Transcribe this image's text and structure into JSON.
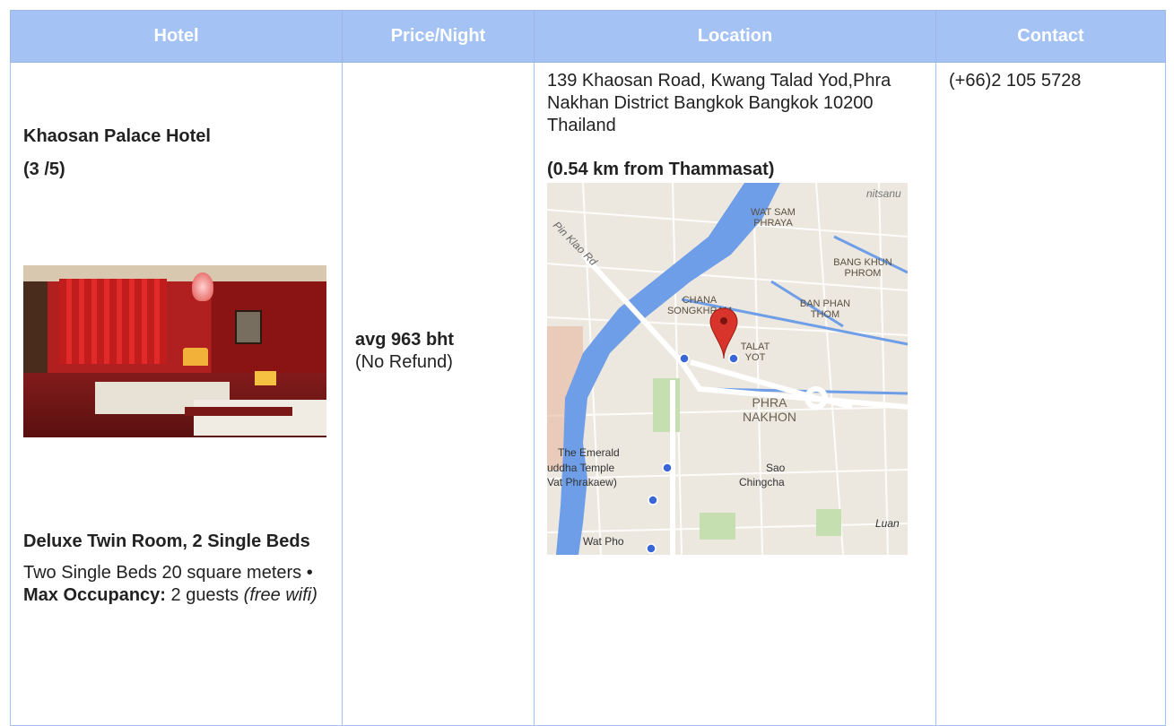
{
  "headers": {
    "hotel": "Hotel",
    "price": "Price/Night",
    "location": "Location",
    "contact": "Contact"
  },
  "hotel": {
    "name": "Khaosan Palace Hotel",
    "rating": "(3 /5)",
    "room_name": "Deluxe Twin Room, 2 Single Beds",
    "room_desc_prefix": "Two Single Beds 20 square meters • ",
    "max_occupancy_label": "Max Occupancy:",
    "max_occupancy_value": " 2 guests ",
    "wifi": "(free wifi)"
  },
  "price": {
    "avg": "avg 963 bht",
    "refund": "(No Refund)"
  },
  "location": {
    "address": "139 Khaosan Road, Kwang Talad Yod,Phra Nakhan District Bangkok Bangkok 10200 Thailand",
    "distance": "(0.54 km from Thammasat)",
    "map_labels": {
      "wat_sam_phraya_1": "WAT SAM",
      "wat_sam_phraya_2": "PHRAYA",
      "bang_khun_phrom_1": "BANG KHUN",
      "bang_khun_phrom_2": "PHROM",
      "chana_songkhram_1": "CHANA",
      "chana_songkhram_2": "SONGKHRAM",
      "ban_phan_thom_1": "BAN PHAN",
      "ban_phan_thom_2": "THOM",
      "talat_yot_1": "TALAT",
      "talat_yot_2": "YOT",
      "phra_nakhon_1": "PHRA",
      "phra_nakhon_2": "NAKHON",
      "emerald_1": "The Emerald",
      "emerald_2": "uddha Temple",
      "emerald_3": "Vat Phrakaew)",
      "sao_1": "Sao",
      "sao_2": "Chingcha",
      "wat_pho": "Wat Pho",
      "pin_klao": "Pin Klao Rd",
      "luan": "Luan",
      "nitsanu": "nitsanu"
    }
  },
  "contact": {
    "phone": "(+66)2 105 5728"
  },
  "colors": {
    "header_bg": "#a4c2f4",
    "border": "#a4c2f4",
    "river": "#6f9ee8",
    "map_bg": "#ece8df",
    "pin": "#d9342b"
  }
}
